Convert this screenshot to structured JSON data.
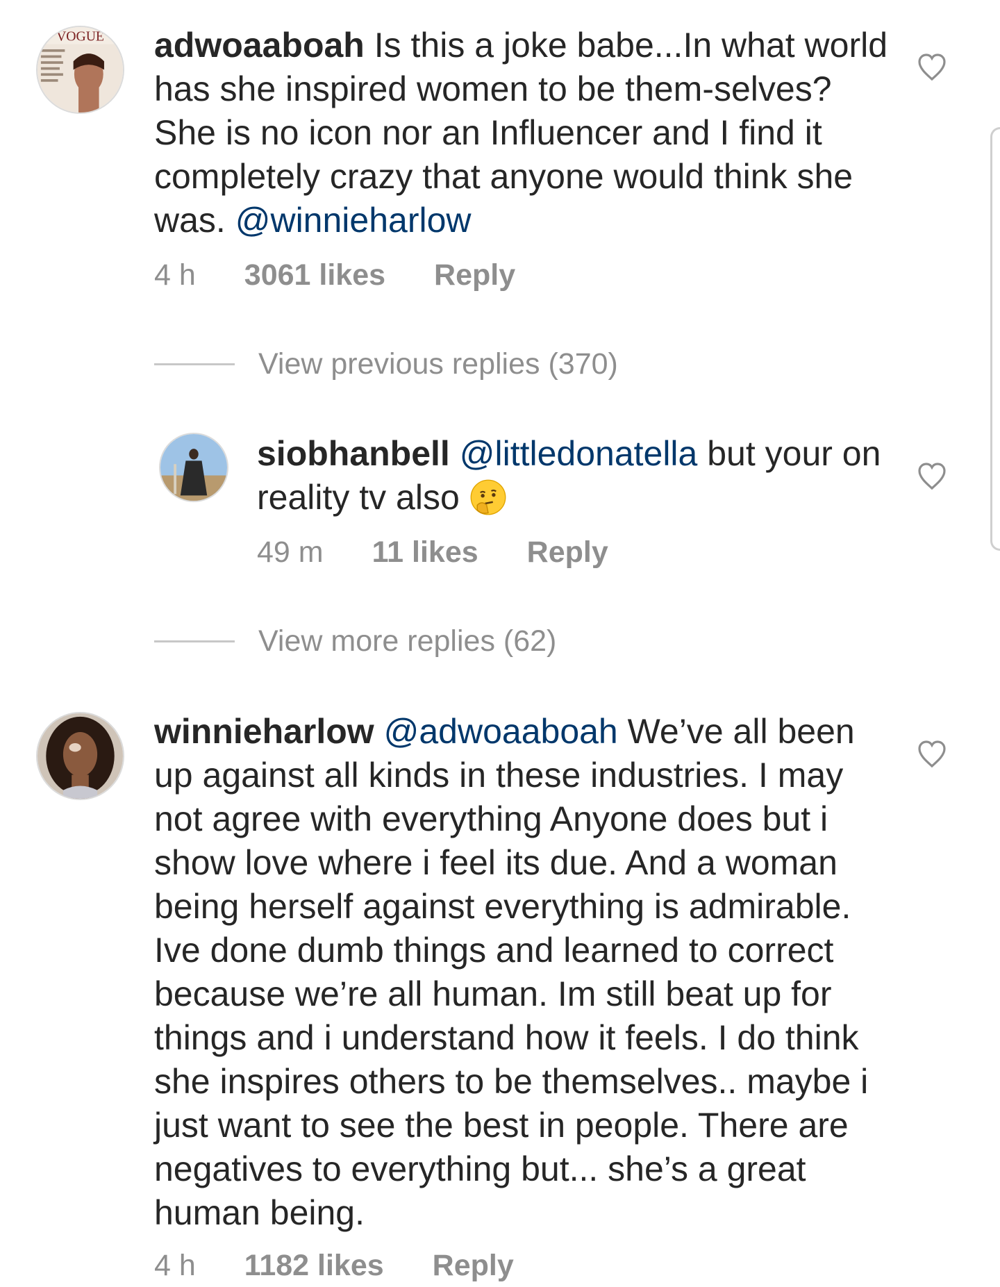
{
  "comments": [
    {
      "username": "adwoaaboah",
      "text_before": " Is this a joke babe...In what world has she inspired women to be them-selves? She is no icon nor an Influencer and I find it completely crazy that anyone would think she was. ",
      "mention": "@winnieharlow",
      "text_after": "",
      "time": "4 h",
      "likes": "3061 likes",
      "reply": "Reply",
      "avatar_icon": "vogue-cover-avatar"
    },
    {
      "username": "siobhanbell",
      "text_before": " ",
      "mention": "@littledonatella",
      "text_after": " but your on reality tv also ",
      "emoji": "thinking-face-emoji",
      "time": "49 m",
      "likes": "11 likes",
      "reply": "Reply",
      "avatar_icon": "siobhanbell-avatar"
    },
    {
      "username": "winnieharlow",
      "text_before": " ",
      "mention": "@adwoaaboah",
      "text_after": " We’ve all been up against all kinds in these industries. I may not agree with everything Anyone does but i show love where i feel its due. And a woman being herself against everything is admirable. Ive done dumb things and learned to correct because we’re all human. Im still beat up for things and i understand how it feels. I do think she inspires others to be themselves.. maybe i just want to see the best in people. There are negatives to everything but... she’s a great human being.",
      "time": "4 h",
      "likes": "1182 likes",
      "reply": "Reply",
      "avatar_icon": "winnieharlow-avatar"
    }
  ],
  "view_previous_replies": "View previous replies (370)",
  "view_more_replies": "View more replies (62)",
  "colors": {
    "text": "#262626",
    "mention": "#00376b",
    "secondary": "#8e8e8e",
    "divider": "#c7c7c7"
  },
  "icons": {
    "like": "heart-outline-icon"
  }
}
